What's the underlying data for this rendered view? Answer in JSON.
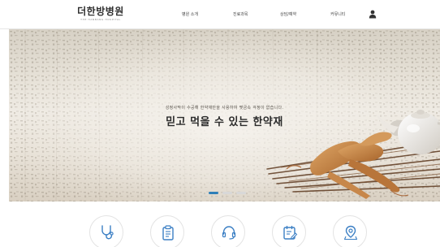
{
  "header": {
    "logo_text": "더한방병원",
    "logo_sub": "THE HANBANG HOSPITAL",
    "nav": [
      "병원 소개",
      "진료과목",
      "상담/예약",
      "커뮤니티"
    ],
    "user_icon": "user-icon"
  },
  "hero": {
    "subtitle": "성정사막이 수공해 한약재만을 사용하여 몇금속 걱정이 없습니다.",
    "title": "믿고 먹을 수 있는 한약재",
    "slides": 3,
    "active_slide": 1
  },
  "services": [
    {
      "icon": "stethoscope-icon"
    },
    {
      "icon": "clipboard-icon"
    },
    {
      "icon": "headset-icon"
    },
    {
      "icon": "calendar-edit-icon"
    },
    {
      "icon": "location-pin-icon"
    }
  ],
  "colors": {
    "accent": "#2f7fb8",
    "icon_stroke": "#3b7fc4",
    "text_dark": "#2b2b2b"
  }
}
